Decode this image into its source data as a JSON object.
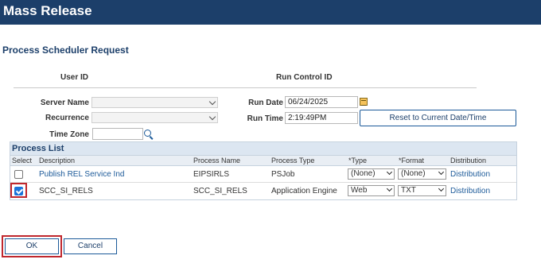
{
  "header": {
    "title": "Mass Release"
  },
  "page": {
    "section_title": "Process Scheduler Request"
  },
  "request_header": {
    "user_id_label": "User ID",
    "run_control_label": "Run Control ID"
  },
  "form": {
    "server_name_label": "Server Name",
    "server_name_value": "",
    "recurrence_label": "Recurrence",
    "recurrence_value": "",
    "time_zone_label": "Time Zone",
    "time_zone_value": "",
    "run_date_label": "Run Date",
    "run_date_value": "06/24/2025",
    "run_time_label": "Run Time",
    "run_time_value": "2:19:49PM",
    "reset_button": "Reset to Current Date/Time",
    "icons": {
      "calendar": "calendar-icon",
      "lookup": "search-icon"
    }
  },
  "process_list": {
    "title": "Process List",
    "columns": [
      "Select",
      "Description",
      "Process Name",
      "Process Type",
      "*Type",
      "*Format",
      "Distribution"
    ],
    "rows": [
      {
        "selected": false,
        "description": "Publish REL Service Ind",
        "process_name": "EIPSIRLS",
        "process_type": "PSJob",
        "type": "(None)",
        "format": "(None)",
        "distribution": "Distribution"
      },
      {
        "selected": true,
        "description": "SCC_SI_RELS",
        "process_name": "SCC_SI_RELS",
        "process_type": "Application Engine",
        "type": "Web",
        "format": "TXT",
        "distribution": "Distribution"
      }
    ]
  },
  "footer": {
    "ok_label": "OK",
    "cancel_label": "Cancel"
  },
  "colors": {
    "header_bg": "#1c3f6a",
    "highlight": "#c0272d",
    "link": "#1c5a99"
  }
}
